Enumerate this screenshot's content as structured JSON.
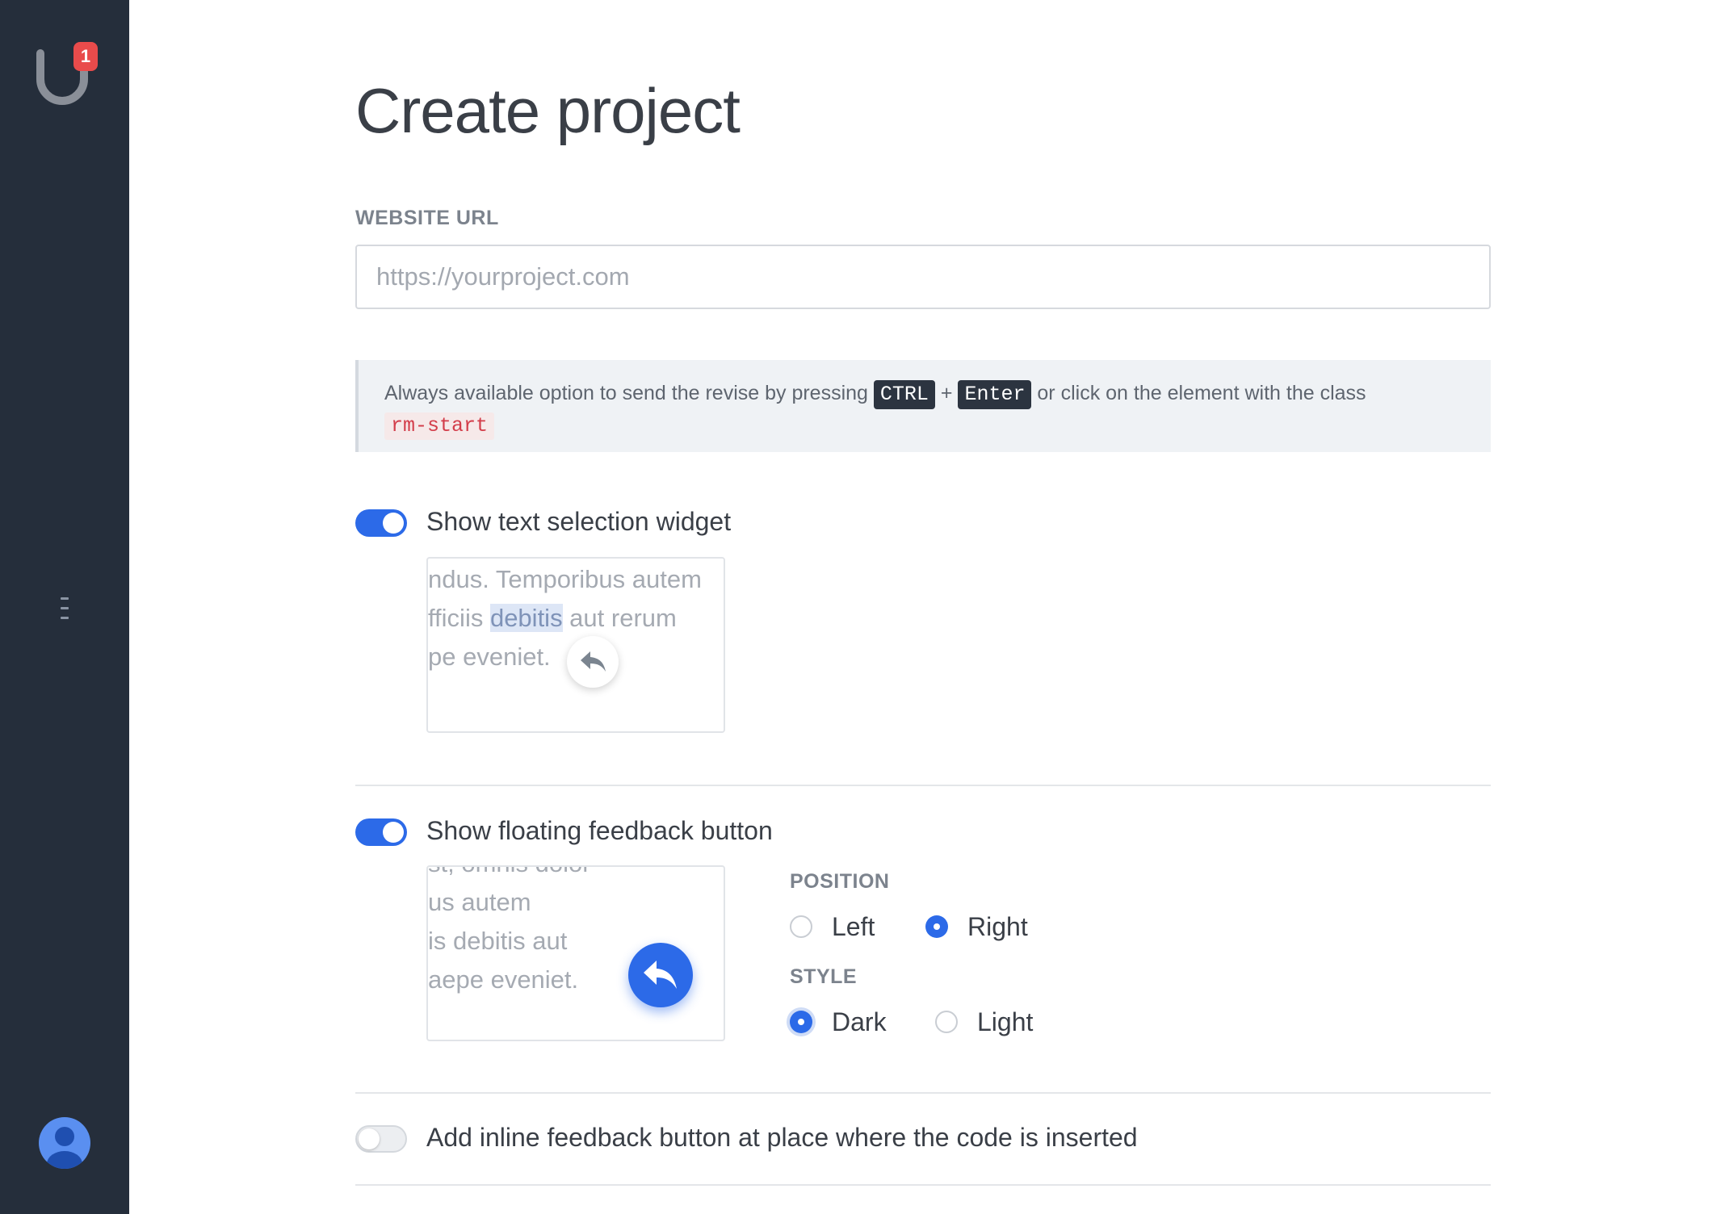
{
  "sidebar": {
    "notification_count": "1",
    "icons": [
      "logo-icon",
      "sidebar-toggle-icon",
      "user-avatar-icon"
    ]
  },
  "page": {
    "title": "Create project"
  },
  "website_url": {
    "label": "WEBSITE URL",
    "placeholder": "https://yourproject.com",
    "value": ""
  },
  "info": {
    "text_before": "Always available option to send the revise by pressing",
    "key1": "CTRL",
    "plus": "+",
    "key2": "Enter",
    "text_after": "or click on the element with the class",
    "class_name": "rm-start"
  },
  "text_selection_widget": {
    "label": "Show text selection widget",
    "enabled": true,
    "preview_lines": [
      "ndus. Temporibus autem",
      "fficiis ",
      "debitis",
      " aut rerum",
      "pe eveniet."
    ]
  },
  "floating_button": {
    "label": "Show floating feedback button",
    "enabled": true,
    "preview_lines": [
      "st, omnis dolor",
      "us autem",
      "is debitis aut",
      "aepe eveniet."
    ],
    "position": {
      "label": "POSITION",
      "options": [
        "Left",
        "Right"
      ],
      "selected": "Right"
    },
    "style": {
      "label": "STYLE",
      "options": [
        "Dark",
        "Light"
      ],
      "selected": "Dark"
    }
  },
  "inline_button": {
    "label": "Add inline feedback button at place where the code is inserted",
    "enabled": false
  },
  "colors": {
    "sidebar_bg": "#252e3b",
    "accent": "#2c6ae8",
    "badge": "#e94b4b"
  }
}
